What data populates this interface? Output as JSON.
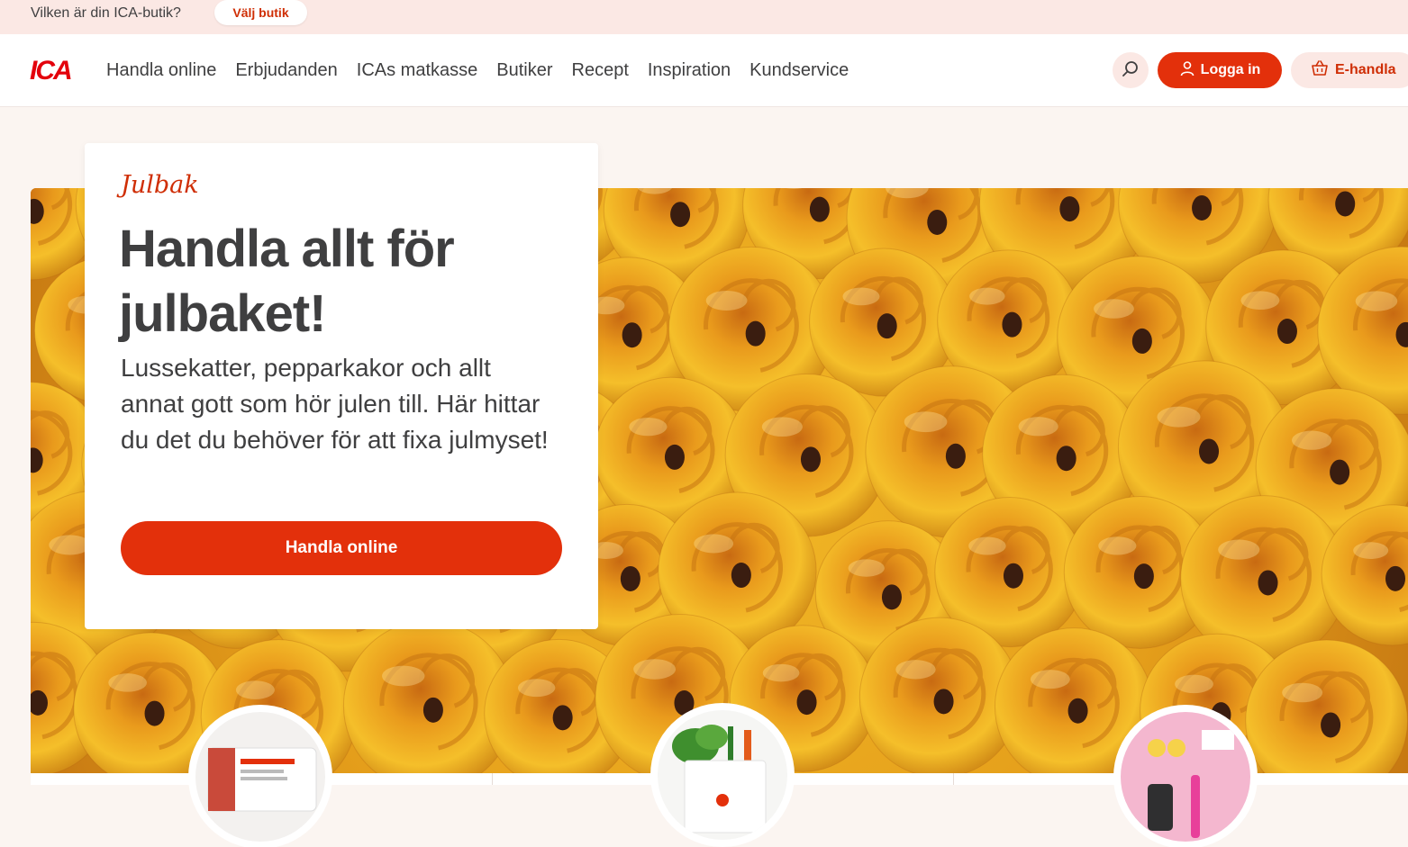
{
  "topbar": {
    "question": "Vilken är din ICA-butik?",
    "select_store_label": "Välj butik"
  },
  "header": {
    "logo_text": "ICA",
    "nav": [
      "Handla online",
      "Erbjudanden",
      "ICAs matkasse",
      "Butiker",
      "Recept",
      "Inspiration",
      "Kundservice"
    ],
    "search_icon": "search-icon",
    "login_label": "Logga in",
    "ehandla_label": "E-handla"
  },
  "hero": {
    "eyebrow": "Julbak",
    "title": "Handla allt för julbaket!",
    "body": "Lussekatter, pepparkakor och allt annat gott som hör julen till. Här hittar du det du behöver för att fixa julmyset!",
    "cta_label": "Handla online"
  },
  "colors": {
    "brand_red": "#e3300b",
    "text_red": "#cf2e05",
    "topbar_bg": "#fbe8e4",
    "page_bg": "#fbf5f1",
    "text_dark": "#3f3f40"
  },
  "thumbnails": [
    {
      "name": "delivery-van-thumb"
    },
    {
      "name": "grocery-bag-thumb"
    },
    {
      "name": "products-thumb"
    }
  ]
}
